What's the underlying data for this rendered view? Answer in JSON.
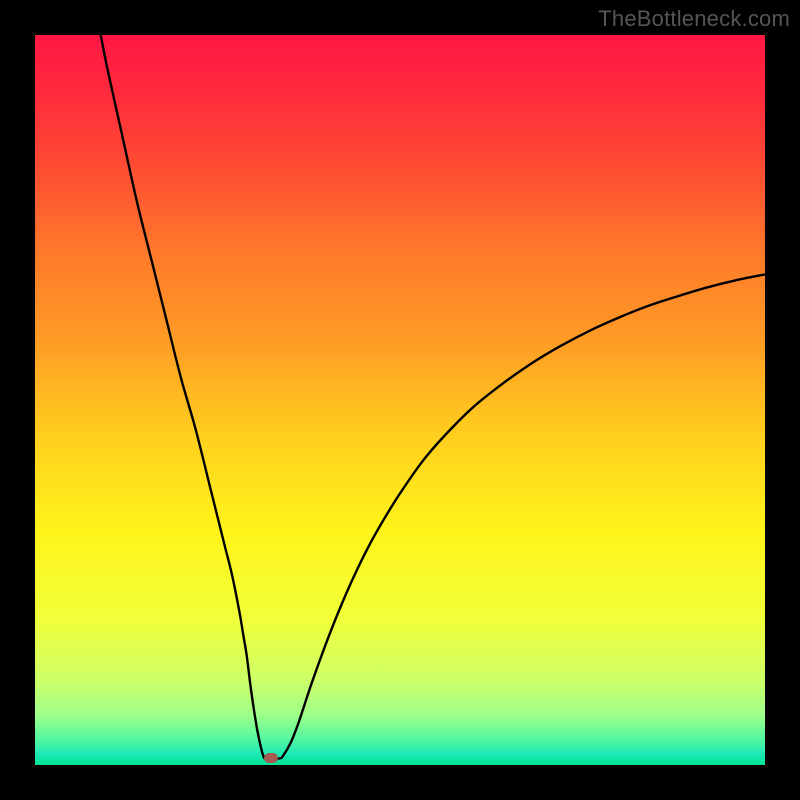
{
  "watermark": "TheBottleneck.com",
  "chart_data": {
    "type": "line",
    "title": "",
    "xlabel": "",
    "ylabel": "",
    "xlim": [
      0,
      100
    ],
    "ylim": [
      0,
      100
    ],
    "grid": false,
    "legend": false,
    "gradient_stops": [
      {
        "offset": 0.0,
        "color": "#ff1744"
      },
      {
        "offset": 0.08,
        "color": "#ff2a3d"
      },
      {
        "offset": 0.18,
        "color": "#ff4c33"
      },
      {
        "offset": 0.3,
        "color": "#ff7a2b"
      },
      {
        "offset": 0.42,
        "color": "#ff9c25"
      },
      {
        "offset": 0.55,
        "color": "#ffcf1e"
      },
      {
        "offset": 0.68,
        "color": "#fff41a"
      },
      {
        "offset": 0.8,
        "color": "#f1ff3a"
      },
      {
        "offset": 0.88,
        "color": "#cfff66"
      },
      {
        "offset": 0.93,
        "color": "#a0ff88"
      },
      {
        "offset": 0.965,
        "color": "#55f7a0"
      },
      {
        "offset": 0.985,
        "color": "#1de9b6"
      },
      {
        "offset": 1.0,
        "color": "#00e38f"
      }
    ],
    "series": [
      {
        "name": "curve",
        "x": [
          9,
          10,
          12,
          14,
          16,
          18,
          20,
          22,
          24,
          25,
          26,
          27,
          28,
          28.5,
          29,
          29.5,
          30,
          30.5,
          31,
          31.3,
          31.6,
          33.5,
          34,
          35,
          36,
          37,
          38,
          40,
          42,
          44,
          46,
          48,
          50,
          53,
          56,
          60,
          64,
          68,
          72,
          76,
          80,
          84,
          88,
          92,
          96,
          100
        ],
        "y": [
          100,
          95,
          86,
          77,
          69,
          61,
          53,
          46,
          38,
          34,
          30,
          26,
          21,
          18,
          15,
          11,
          7.5,
          4.5,
          2.2,
          1.2,
          0.9,
          0.9,
          1.3,
          3.0,
          5.5,
          8.5,
          11.5,
          17,
          22,
          26.5,
          30.5,
          34,
          37.2,
          41.5,
          45,
          49,
          52.2,
          55,
          57.4,
          59.5,
          61.3,
          62.9,
          64.2,
          65.4,
          66.4,
          67.2
        ]
      }
    ],
    "marker": {
      "x": 32.3,
      "y": 0.9,
      "color": "#a35a52"
    }
  }
}
